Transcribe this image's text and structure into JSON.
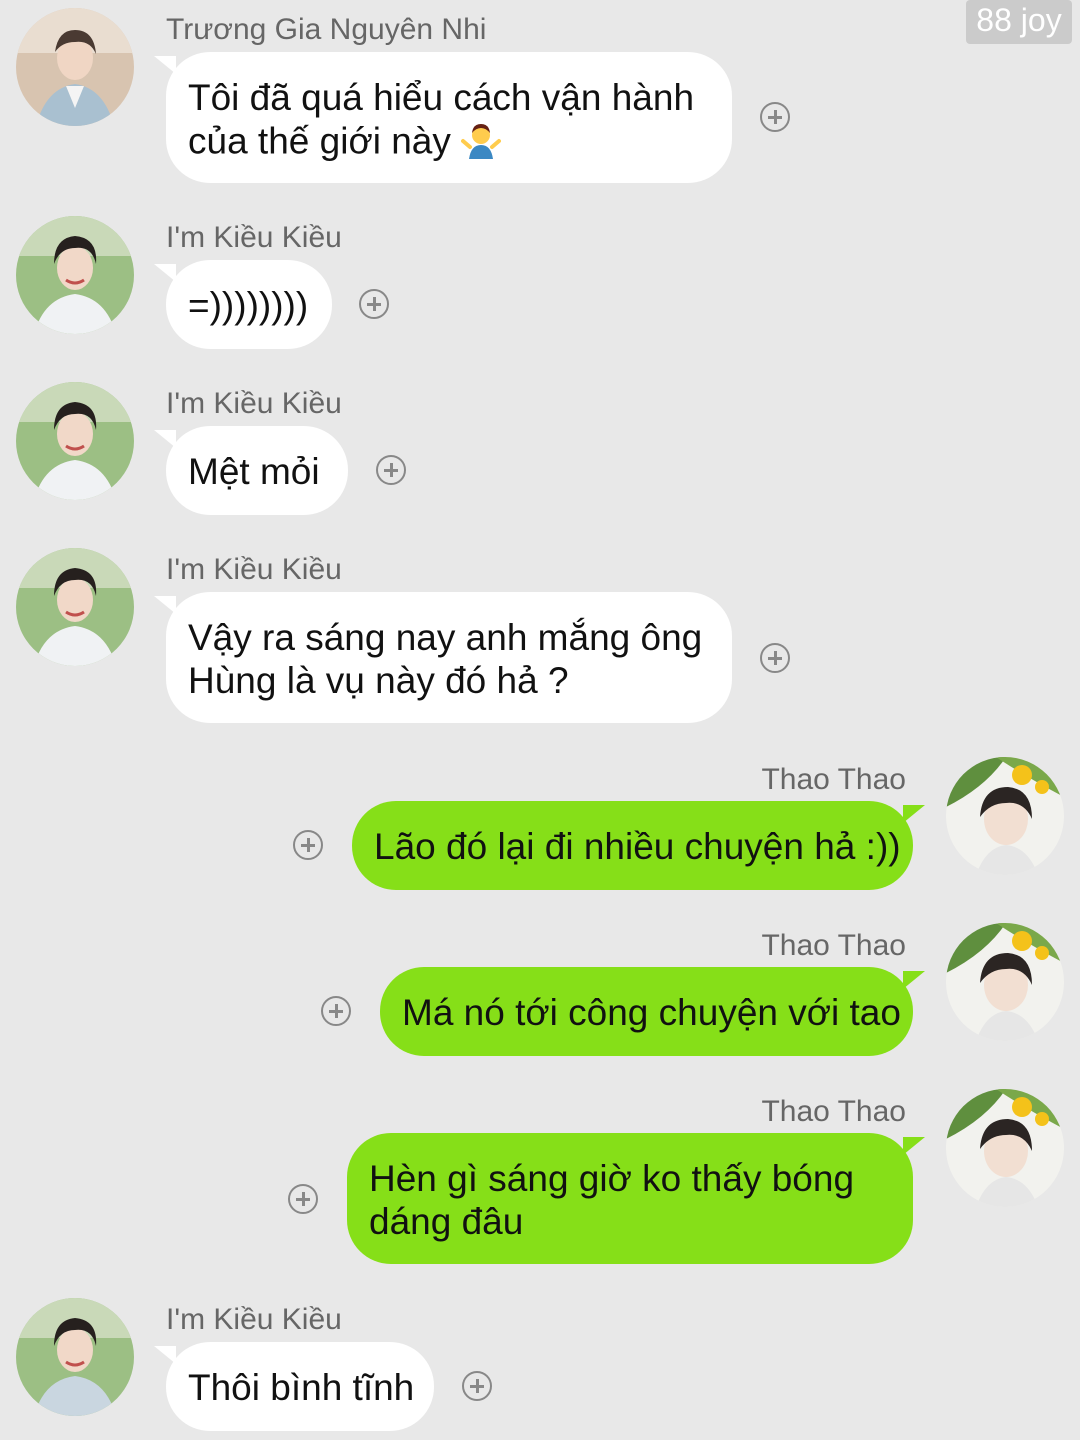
{
  "watermark": "88 joy",
  "messages": [
    {
      "sender": "Trương Gia Nguyên Nhi",
      "line1": "Tôi đã quá hiểu cách vận hành",
      "line2": "của thế giới này",
      "emoji": "person-shrugging-icon"
    },
    {
      "sender": "I'm Kiều Kiều",
      "line1": "=))))))))"
    },
    {
      "sender": "I'm Kiều Kiều",
      "line1": "Mệt mỏi"
    },
    {
      "sender": "I'm Kiều Kiều",
      "line1": "Vậy ra sáng nay anh mắng ông",
      "line2": "Hùng là vụ này đó hả ?"
    },
    {
      "sender": "Thao Thao",
      "line1": "Lão đó lại đi nhiều chuyện hả :))"
    },
    {
      "sender": "Thao Thao",
      "line1": "Má nó tới công chuyện với tao"
    },
    {
      "sender": "Thao Thao",
      "line1": "Hèn gì sáng giờ ko thấy bóng",
      "line2": "dáng đâu"
    },
    {
      "sender": "I'm Kiều Kiều",
      "line1": "Thôi bình tĩnh"
    }
  ],
  "colors": {
    "background": "#e8e8e8",
    "incoming_bubble": "#ffffff",
    "outgoing_bubble": "#86df18",
    "sender_name": "#666666"
  }
}
